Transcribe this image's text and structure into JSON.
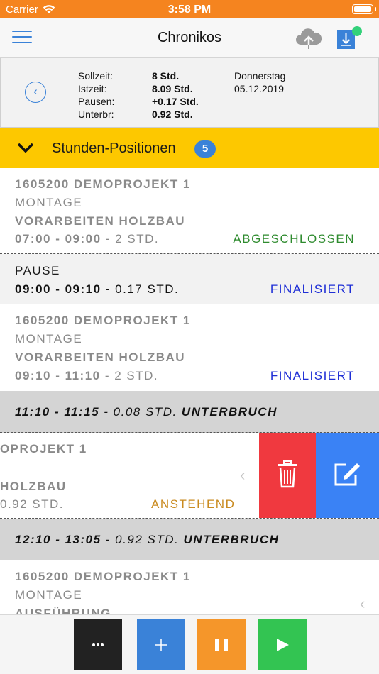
{
  "status_bar": {
    "carrier": "Carrier",
    "time": "3:58 PM",
    "status_color": "#f5841f"
  },
  "nav": {
    "title": "Chronikos",
    "icons": [
      "menu-icon",
      "cloud-upload-icon",
      "download-icon"
    ],
    "sync_dot_color": "#33d17a"
  },
  "summary": {
    "labels": [
      "Sollzeit:",
      "Istzeit:",
      "Pausen:",
      "Unterbr:"
    ],
    "values": [
      "8 Std.",
      "8.09 Std.",
      "+0.17 Std.",
      "0.92 Std."
    ],
    "weekday": "Donnerstag",
    "date": "05.12.2019"
  },
  "section": {
    "title": "Stunden-Positionen",
    "count": "5",
    "color": "#fdc800"
  },
  "entries": [
    {
      "project": "1605200 DEMOPROJEKT 1",
      "category": "MONTAGE",
      "task": "VORARBEITEN HOLZBAU",
      "time_range": "07:00 - 09:00",
      "duration": " - 2 STD.",
      "status": "ABGESCHLOSSEN",
      "status_color": "#2e8b2e"
    },
    {
      "label": "PAUSE",
      "time_range": "09:00 - 09:10",
      "duration": " - 0.17 STD.",
      "status": "FINALISIERT",
      "status_color": "#1f2fd6"
    },
    {
      "project": "1605200 DEMOPROJEKT 1",
      "category": "MONTAGE",
      "task": "VORARBEITEN HOLZBAU",
      "time_range": "09:10 - 11:10",
      "duration": " - 2 STD.",
      "status": "FINALISIERT",
      "status_color": "#1f2fd6"
    },
    {
      "time_range": "11:10 - 11:15",
      "duration": " - 0.08 STD. ",
      "type": "UNTERBRUCH"
    },
    {
      "project_visible": "OPROJEKT 1",
      "task_visible": "HOLZBAU",
      "duration_visible": "0.92 STD.",
      "status": "ANSTEHEND",
      "status_color": "#c98a1e",
      "swipe_actions": [
        "trash-icon",
        "edit-icon"
      ]
    },
    {
      "time_range": "12:10 - 13:05",
      "duration": " - 0.92 STD. ",
      "type": "UNTERBRUCH"
    },
    {
      "project": "1605200 DEMOPROJEKT 1",
      "category": "MONTAGE",
      "task": "AUSFÜHRUNG"
    }
  ],
  "toolbar": {
    "more": "•••",
    "add": "+",
    "icons": [
      "more-icon",
      "add-icon",
      "pause-icon",
      "play-icon"
    ]
  }
}
